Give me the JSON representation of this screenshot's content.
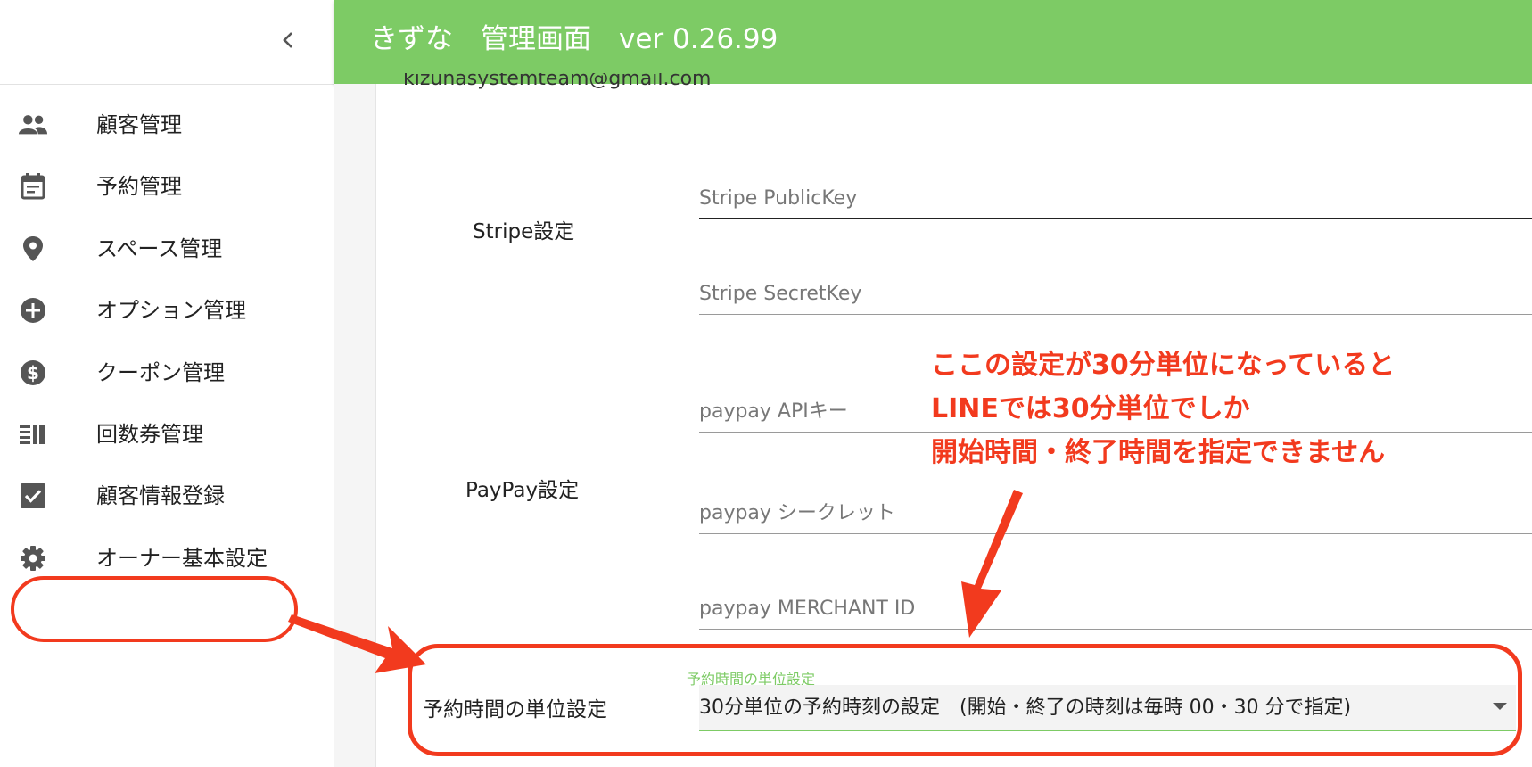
{
  "header": {
    "title": "きずな　管理画面　ver 0.26.99",
    "bg_color": "#7dcb65"
  },
  "sidebar": {
    "collapse_icon": "chevron-left-icon",
    "items": [
      {
        "label": "顧客管理",
        "icon": "people-icon"
      },
      {
        "label": "予約管理",
        "icon": "calendar-icon"
      },
      {
        "label": "スペース管理",
        "icon": "location-pin-icon"
      },
      {
        "label": "オプション管理",
        "icon": "add-circle-icon"
      },
      {
        "label": "クーポン管理",
        "icon": "dollar-circle-icon"
      },
      {
        "label": "回数券管理",
        "icon": "ticket-list-icon"
      },
      {
        "label": "顧客情報登録",
        "icon": "checkbox-icon"
      },
      {
        "label": "オーナー基本設定",
        "icon": "gear-icon"
      }
    ]
  },
  "form": {
    "email_value": "kizunasystemteam@gmail.com",
    "stripe": {
      "section_label": "Stripe設定",
      "public_key_placeholder": "Stripe PublicKey",
      "secret_key_placeholder": "Stripe SecretKey"
    },
    "paypay": {
      "section_label": "PayPay設定",
      "api_key_placeholder": "paypay APIキー",
      "secret_placeholder": "paypay シークレット",
      "merchant_id_placeholder": "paypay MERCHANT ID"
    },
    "time_unit": {
      "section_label": "予約時間の単位設定",
      "field_label": "予約時間の単位設定",
      "selected_value": "30分単位の予約時刻の設定　(開始・終了の時刻は毎時 00・30 分で指定)",
      "accent_color": "#7dcb65"
    }
  },
  "annotation": {
    "lines": [
      "ここの設定が30分単位になっていると",
      "LINEでは30分単位でしか",
      "開始時間・終了時間を指定できません"
    ],
    "color": "#f23a1e"
  }
}
